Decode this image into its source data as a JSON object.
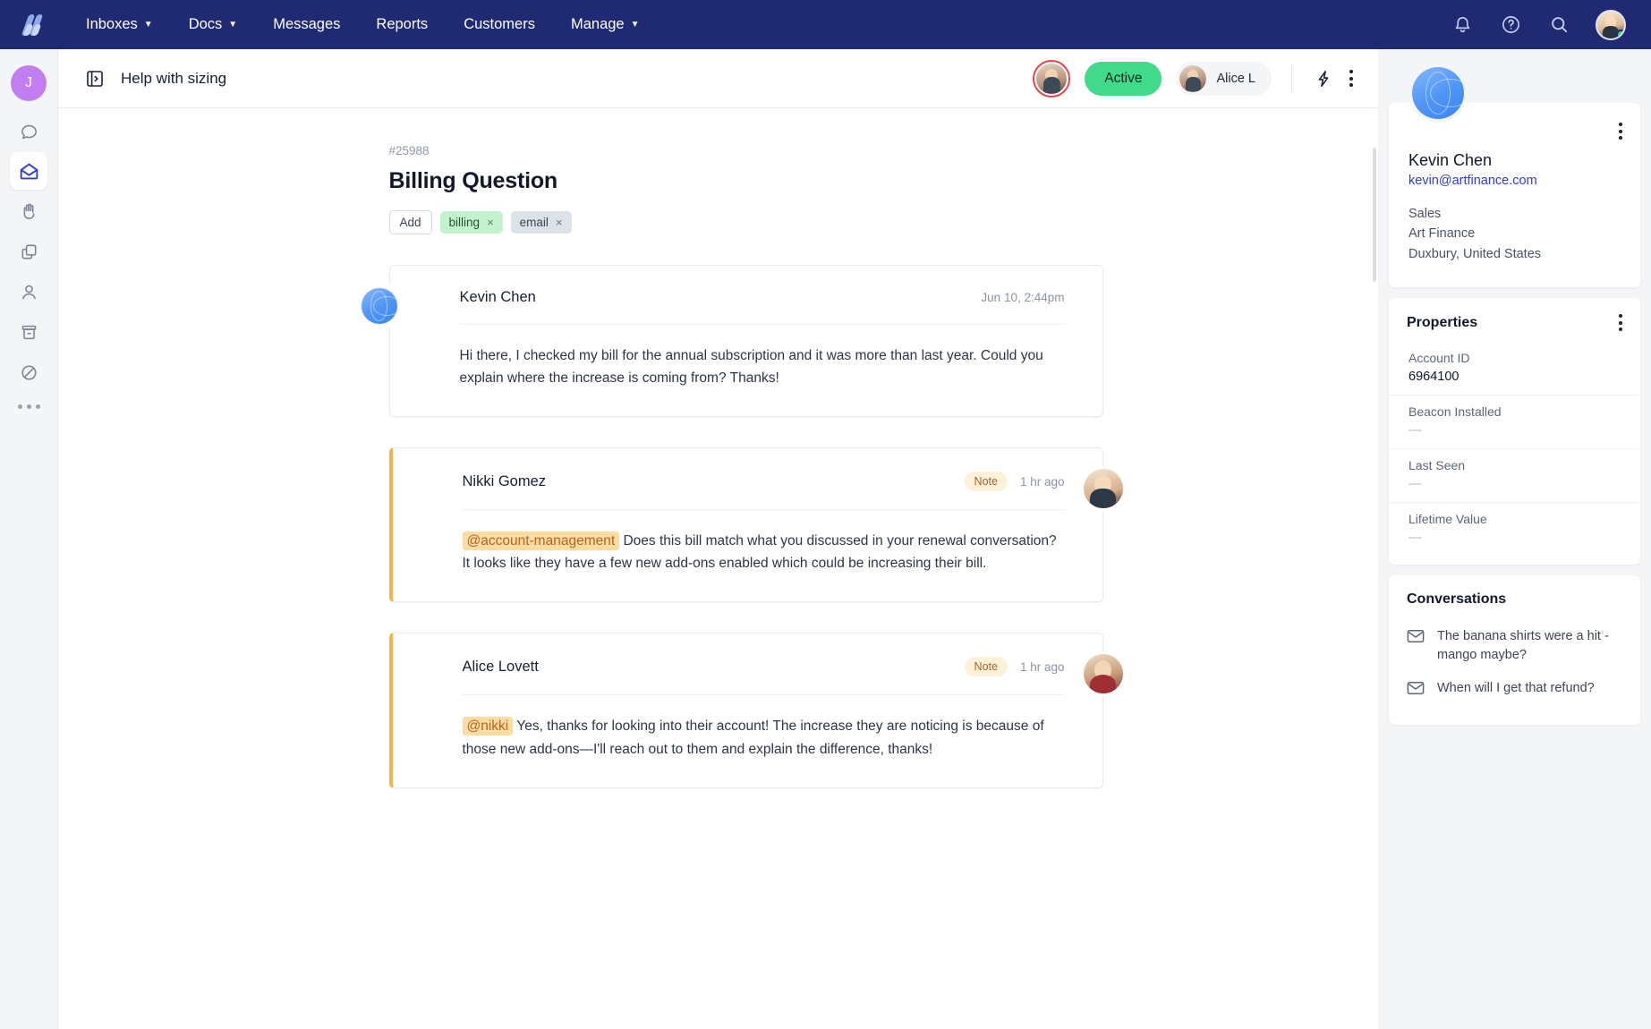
{
  "topnav": {
    "logo_name": "helpscout-logo",
    "items": [
      {
        "label": "Inboxes",
        "caret": true
      },
      {
        "label": "Docs",
        "caret": true
      },
      {
        "label": "Messages",
        "caret": false
      },
      {
        "label": "Reports",
        "caret": false
      },
      {
        "label": "Customers",
        "caret": false
      },
      {
        "label": "Manage",
        "caret": true
      }
    ],
    "icons": [
      "bell-icon",
      "help-circle-icon",
      "search-icon"
    ],
    "avatar": "user-avatar",
    "status_color": "#36d576",
    "background": "#1f2a72"
  },
  "rail": {
    "avatar_initial": "J",
    "avatar_color": "#c07ef0",
    "items": [
      {
        "name": "chat-bubble-icon",
        "active": false
      },
      {
        "name": "open-envelope-icon",
        "active": true
      },
      {
        "name": "raised-hand-icon",
        "active": false
      },
      {
        "name": "documents-icon",
        "active": false
      },
      {
        "name": "person-icon",
        "active": false
      },
      {
        "name": "archive-icon",
        "active": false
      },
      {
        "name": "blocked-icon",
        "active": false
      }
    ],
    "more_label": "more-options"
  },
  "conv_header": {
    "toggle_icon": "panel-toggle-icon",
    "title": "Help with sizing",
    "customer_avatar": "customer-avatar",
    "status_label": "Active",
    "status_color": "#41d98a",
    "assignee_label": "Alice L",
    "lightning_icon": "lightning-bolt-icon",
    "kebab_icon": "more-options-icon"
  },
  "conversation": {
    "number": "#25988",
    "subject": "Billing Question",
    "tags": {
      "add_label": "Add",
      "items": [
        {
          "label": "billing",
          "color": "green",
          "close": "×"
        },
        {
          "label": "email",
          "color": "grey",
          "close": "×"
        }
      ]
    },
    "messages": [
      {
        "author": "Kevin Chen",
        "time": "Jun 10, 2:44pm",
        "is_note": false,
        "badge": "",
        "body": "Hi there, I checked my bill for the annual subscription and it was more than last year. Could you explain where the increase is coming from? Thanks!",
        "mention": "",
        "avatar_side": "left"
      },
      {
        "author": "Nikki Gomez",
        "time": "1 hr ago",
        "is_note": true,
        "badge": "Note",
        "mention": "@account-management",
        "body": "Does this bill match what you discussed in your renewal conversation? It looks like they have a few new add-ons enabled which could be increasing their bill.",
        "avatar_side": "right"
      },
      {
        "author": "Alice Lovett",
        "time": "1 hr ago",
        "is_note": true,
        "badge": "Note",
        "mention": "@nikki",
        "body": "Yes, thanks for looking into their account! The increase they are noticing is because of those new add-ons—I'll reach out to them and explain the difference, thanks!",
        "avatar_side": "right"
      }
    ]
  },
  "sidebar": {
    "customer": {
      "avatar_name": "customer-avatar",
      "name": "Kevin Chen",
      "email": "kevin@artfinance.com",
      "job_title": "Sales",
      "company": "Art Finance",
      "location": "Duxbury, United States",
      "kebab_icon": "more-options-icon"
    },
    "properties": {
      "title": "Properties",
      "kebab_icon": "more-options-icon",
      "items": [
        {
          "label": "Account ID",
          "value": "6964100",
          "empty": false
        },
        {
          "label": "Beacon Installed",
          "value": "—",
          "empty": true
        },
        {
          "label": "Last Seen",
          "value": "—",
          "empty": true
        },
        {
          "label": "Lifetime Value",
          "value": "—",
          "empty": true
        }
      ]
    },
    "conversations": {
      "title": "Conversations",
      "items": [
        {
          "icon": "envelope-icon",
          "label": "The banana shirts were a hit - mango maybe?"
        },
        {
          "icon": "envelope-icon",
          "label": "When will I get that refund?"
        }
      ]
    }
  }
}
